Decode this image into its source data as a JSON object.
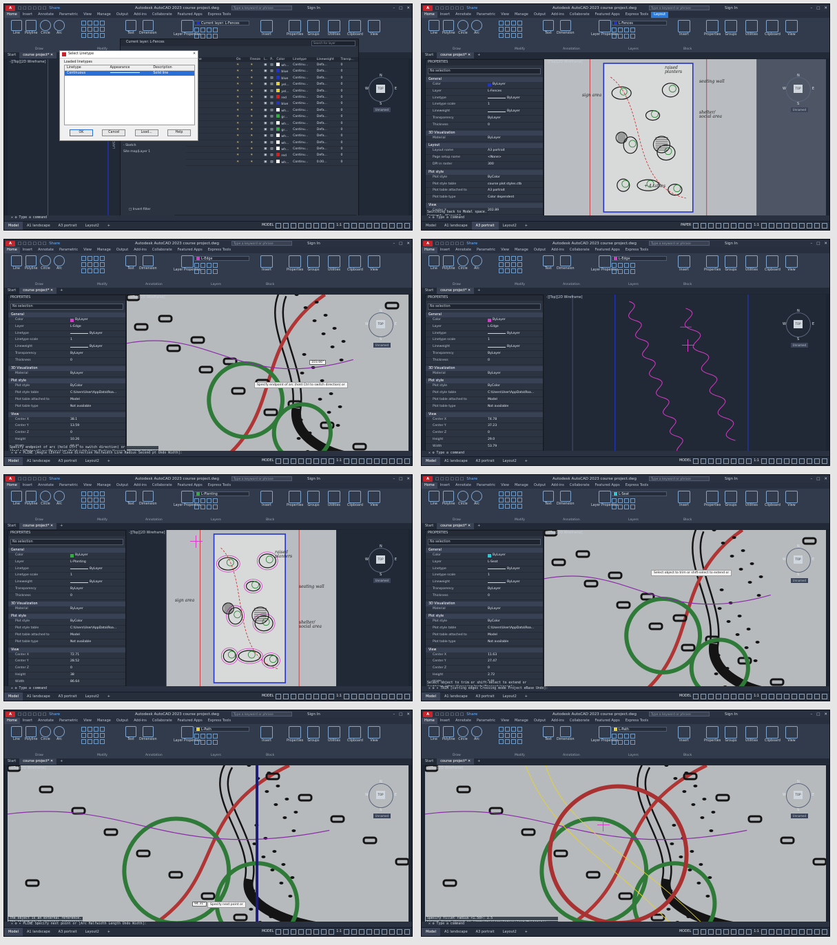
{
  "app": {
    "logo": "A CAD",
    "share_label": "Share",
    "title": "Autodesk AutoCAD 2023    course project.dwg",
    "search_placeholder": "Type a keyword or phrase",
    "sign_in": "Sign In"
  },
  "ribbon": {
    "tabs": [
      "Home",
      "Insert",
      "Annotate",
      "Parametric",
      "View",
      "Manage",
      "Output",
      "Add-ins",
      "Collaborate",
      "Featured Apps",
      "Express Tools"
    ],
    "layout_tab": "Layout",
    "draw_tools": [
      "Line",
      "Polyline",
      "Circle",
      "Arc"
    ],
    "annotation_tools": [
      "Text",
      "Dimension"
    ],
    "layer_properties": "Layer Properties",
    "right_tools": [
      "Insert",
      "Properties",
      "Groups",
      "Utilities",
      "Clipboard",
      "View"
    ],
    "group_names": [
      "Draw",
      "Modify",
      "Annotation",
      "Layers",
      "Block"
    ]
  },
  "doc_tabs": {
    "start": "Start",
    "file": "course project*"
  },
  "layout_tabs": [
    "Model",
    "A1 landscape",
    "A3 portrait",
    "Layout2"
  ],
  "status": {
    "model": "MODEL",
    "paper": "PAPER",
    "scale": "1:1"
  },
  "viewport_label": "-][Top][2D Wireframe]",
  "viewcube": {
    "top": "TOP",
    "n": "N",
    "s": "S",
    "w": "W",
    "e": "E",
    "unnamed": "Unnamed"
  },
  "properties": {
    "title": "PROPERTIES",
    "selection": "No selection",
    "cat_general": "General",
    "cat_3d": "3D Visualization",
    "cat_plot": "Plot style",
    "cat_view": "View",
    "cat_layout": "Layout",
    "general_keys": [
      "Color",
      "Layer",
      "Linetype",
      "Linetype scale",
      "Lineweight",
      "Transparency",
      "Thickness"
    ],
    "material_key": "Material",
    "plot_keys": [
      "Plot style",
      "Plot style table",
      "Plot table attached to",
      "Plot table type"
    ],
    "view_keys": [
      "Center X",
      "Center Y",
      "Center Z",
      "Height",
      "Width"
    ],
    "layout_keys": [
      "Layout name",
      "Page setup name",
      "DPI in raster"
    ]
  },
  "panels": [
    {
      "id": "p1",
      "layer_dropdown": "Current layer: L-Fences",
      "layer_color": "#2233cc",
      "dialog": {
        "title": "Select Linetype",
        "section": "Loaded linetypes",
        "headers": [
          "Linetype",
          "Appearance",
          "Description"
        ],
        "row": {
          "name": "Continuous",
          "desc": "Solid line"
        },
        "buttons": [
          "OK",
          "Cancel",
          "Load...",
          "Help"
        ]
      },
      "layer_manager": {
        "header": "Current layer: L-Fences",
        "search": "Search for layer",
        "columns": [
          "S.",
          "Name",
          "On",
          "Freeze",
          "L..",
          "P..",
          "Color",
          "Linetype",
          "Lineweight",
          "Transp..."
        ],
        "tree": [
          "ding",
          "nd",
          "path",
          "",
          "",
          "",
          "ctures",
          "",
          "eport",
          "",
          "",
          "",
          "- Aerial",
          "- Site Map",
          "- Sketch",
          "Site map|Layer 1"
        ],
        "rows": [
          {
            "color": "wh...",
            "swatch": "#ffffff",
            "ltype": "Continu...",
            "lw": "Defa...",
            "tr": "0"
          },
          {
            "color": "blue",
            "swatch": "#2233cc",
            "ltype": "Continu...",
            "lw": "Defa...",
            "tr": "0"
          },
          {
            "color": "blue",
            "swatch": "#2233cc",
            "ltype": "Continu...",
            "lw": "Defa...",
            "tr": "0"
          },
          {
            "color": "yel...",
            "swatch": "#e6d22a",
            "ltype": "Continu...",
            "lw": "Defa...",
            "tr": "0"
          },
          {
            "color": "yel...",
            "swatch": "#e6d22a",
            "ltype": "Continu...",
            "lw": "Defa...",
            "tr": "0"
          },
          {
            "color": "red",
            "swatch": "#cc2222",
            "ltype": "Continu...",
            "lw": "Defa...",
            "tr": "0"
          },
          {
            "color": "blue",
            "swatch": "#2233cc",
            "ltype": "Continu...",
            "lw": "Defa...",
            "tr": "0"
          },
          {
            "color": "wh...",
            "swatch": "#ffffff",
            "ltype": "Continu...",
            "lw": "Defa...",
            "tr": "0"
          },
          {
            "color": "gr...",
            "swatch": "#2fae3c",
            "ltype": "Continu...",
            "lw": "Defa...",
            "tr": "0"
          },
          {
            "color": "wh...",
            "swatch": "#ffffff",
            "ltype": "Continu...",
            "lw": "Defa...",
            "tr": "0"
          },
          {
            "color": "gr...",
            "swatch": "#2fae3c",
            "ltype": "Continu...",
            "lw": "Defa...",
            "tr": "0"
          },
          {
            "color": "wh...",
            "swatch": "#ffffff",
            "ltype": "Continu...",
            "lw": "Defa...",
            "tr": "0"
          },
          {
            "color": "wh...",
            "swatch": "#ffffff",
            "ltype": "Continu...",
            "lw": "Defa...",
            "tr": "0"
          },
          {
            "color": "wh...",
            "swatch": "#ffffff",
            "ltype": "Continu...",
            "lw": "Defa...",
            "tr": "0"
          },
          {
            "color": "red",
            "swatch": "#cc2222",
            "ltype": "Continu...",
            "lw": "Defa...",
            "tr": "0"
          },
          {
            "color": "wh...",
            "swatch": "#ffffff",
            "ltype": "Continu...",
            "lw": "0.00...",
            "tr": "0"
          }
        ],
        "invert_filter": "Invert filter",
        "footer": "All: 15 layers displayed of 15 total layers",
        "side_banner": "LAYER PROPERTIES MANAGER"
      },
      "cmd_prompt": "Type a command"
    },
    {
      "id": "p2",
      "layer_dropdown": "L-Fences",
      "layer_color": "#2233cc",
      "props": {
        "general": [
          "ByLayer",
          "L-Fences",
          "ByLayer",
          "1",
          "ByLayer",
          "ByLayer",
          "0"
        ],
        "material": "ByLayer",
        "layout": [
          "A3 portrait",
          "<None>",
          "300"
        ],
        "plot": [
          "ByColor",
          "course plot styles.ctb",
          "A3 portrait",
          "Color dependent"
        ],
        "center_x": "202.89"
      },
      "annotations": [
        "seating wall",
        "raised planters",
        "shelter/ social area",
        "+ 4 tables",
        "sign area"
      ],
      "cmd_history": [
        "Switching back to Model space.",
        "Command: *Cancel*",
        "Command: _.PSPACE"
      ],
      "cmd_prompt": "Type a command"
    },
    {
      "id": "p3",
      "layer_dropdown": "L-Edge",
      "layer_color": "#d63cc8",
      "props": {
        "general": [
          "ByLayer",
          "L-Edge",
          "ByLayer",
          "1",
          "ByLayer",
          "ByLayer",
          "0"
        ],
        "material": "ByLayer",
        "plot": [
          "ByColor",
          "C:\\Users\\User\\AppData\\Roa...",
          "Model",
          "Not available"
        ],
        "view": [
          "38.1",
          "13.59",
          "0",
          "10.26",
          "18.31"
        ]
      },
      "tooltip": "Specify endpoint of arc (hold Ctrl to switch direction) or",
      "dim": "103.66°",
      "cmd_history": [
        "Specify endpoint of arc (hold Ctrl to switch direction) or",
        "[Angle/CEnter/CLose/Direction/Halfwidth/Line/Radius/Second pt/Undo/Width]:",
        "Specify endpoint of arc (hold Ctrl to switch direction) or"
      ],
      "cmd_prompt": "PLINE [Angle CEnter CLose Direction Halfwidth Line Radius Second pt Undo Width]:"
    },
    {
      "id": "p4",
      "layer_dropdown": "L-Edge",
      "layer_color": "#d63cc8",
      "props": {
        "general": [
          "ByLayer",
          "L-Edge",
          "ByLayer",
          "1",
          "ByLayer",
          "ByLayer",
          "0"
        ],
        "material": "ByLayer",
        "plot": [
          "ByColor",
          "C:\\Users\\User\\AppData\\Roa...",
          "Model",
          "Not available"
        ],
        "view": [
          "74.78",
          "37.23",
          "0",
          "29.0",
          "53.79"
        ]
      },
      "cmd_prompt": "Type a command"
    },
    {
      "id": "p5",
      "layer_dropdown": "L-Planting",
      "layer_color": "#2fae3c",
      "props": {
        "general": [
          "ByLayer",
          "L-Planting",
          "ByLayer",
          "1",
          "ByLayer",
          "ByLayer",
          "0"
        ],
        "material": "ByLayer",
        "plot": [
          "ByColor",
          "C:\\Users\\User\\AppData\\Roa...",
          "Model",
          "Not available"
        ],
        "view": [
          "72.71",
          "28.52",
          "0",
          "38",
          "86.64"
        ]
      },
      "annotations": [
        "raised planters",
        "seating wall",
        "shelter/ social area",
        "sign area"
      ],
      "cmd_prompt": "Type a command"
    },
    {
      "id": "p6",
      "layer_dropdown": "L-Seat",
      "layer_color": "#27c9d6",
      "props": {
        "general": [
          "ByLayer",
          "L-Seat",
          "ByLayer",
          "1",
          "ByLayer",
          "ByLayer",
          "0"
        ],
        "material": "ByLayer",
        "plot": [
          "ByColor",
          "C:\\Users\\User\\AppData\\Roa...",
          "Model",
          "Not available"
        ],
        "view": [
          "11.63",
          "27.47",
          "0",
          "2.72",
          "5.01"
        ]
      },
      "tooltip": "Select object to trim or shift-select to extend or",
      "cmd_history": [
        "Select object to trim or shift-select to extend or",
        "[cutting edges/Crossing/mode/Project/erase]:",
        "Select object to trim or shift-select to extend or"
      ],
      "cmd_prompt": "TRIM [cutting edges Crossing mode Project eRase Undo]:"
    },
    {
      "id": "p7",
      "layer_dropdown": "L-Path",
      "layer_color": "#e6d22a",
      "tooltip": "Specify next point or",
      "dim": "94.31°",
      "cmd_history": [
        "The object is an external reference.",
        "The object is an external reference.",
        "Current line-width is 0.00"
      ],
      "cmd_prompt": "PLINE Specify next point or [Arc Halfwidth Length Undo Width]:"
    },
    {
      "id": "p8",
      "layer_dropdown": "L-Path",
      "layer_color": "#e6d22a",
      "cmd_history": [
        "Specify fillet radius <1.50>: 1.5",
        "Select first object or [Undo/Polyline/Radius/Trim/Multiple]:",
        "Select second object or shift-select to apply corner or [Radius]:"
      ],
      "cmd_prompt": "Type a command"
    }
  ]
}
